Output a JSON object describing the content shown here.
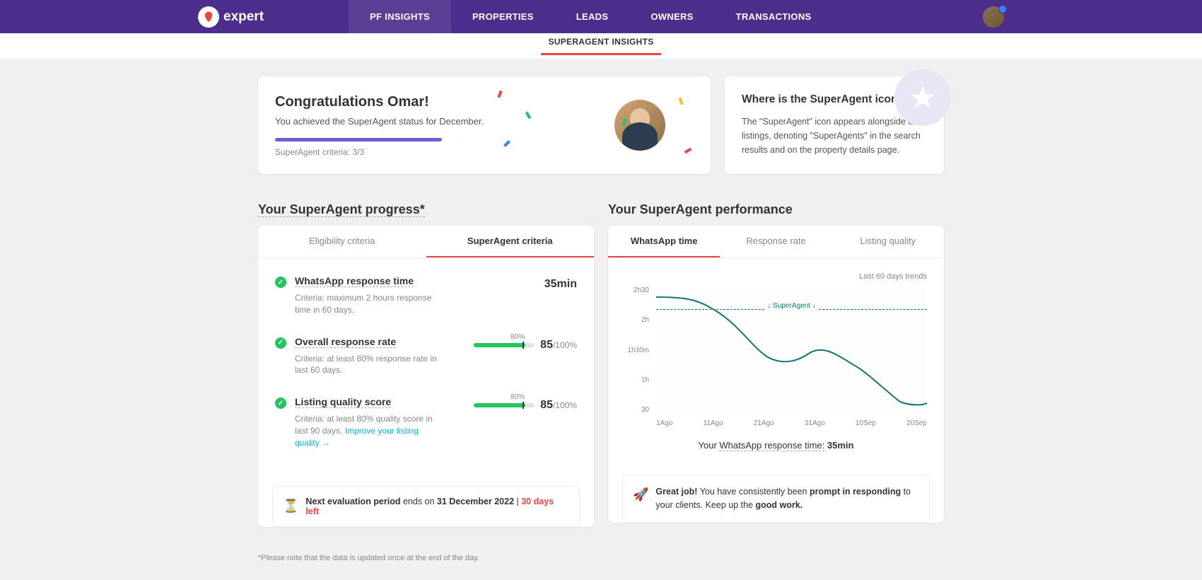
{
  "brand": {
    "name": "expert"
  },
  "nav": {
    "items": [
      "PF INSIGHTS",
      "PROPERTIES",
      "LEADS",
      "OWNERS",
      "TRANSACTIONS"
    ],
    "active_index": 0
  },
  "subnav": {
    "tab": "SUPERAGENT INSIGHTS"
  },
  "congrats": {
    "title": "Congratulations Omar!",
    "subtitle": "You achieved the SuperAgent status for December.",
    "criteria_text": "SuperAgent criteria: 3/3",
    "progress_pct": 100
  },
  "info": {
    "title": "Where is the SuperAgent icon?",
    "body": "The \"SuperAgent\" icon appears alongside all listings, denoting \"SuperAgents\" in the search results and on the property details page."
  },
  "progress_section": {
    "title": "Your SuperAgent progress*",
    "tabs": {
      "left": "Eligibility criteria",
      "right": "SuperAgent criteria",
      "active": "right"
    },
    "criteria": [
      {
        "name": "WhatsApp response time",
        "desc": "Criteria: maximum 2 hours response time in 60 days.",
        "value": "35min",
        "type": "time"
      },
      {
        "name": "Overall response rate",
        "desc": "Criteria: at least 80% response rate in last 60 days.",
        "value": "85",
        "suffix": "/100%",
        "bar_label": "80%",
        "bar_pct": 85,
        "type": "pct"
      },
      {
        "name": "Listing quality score",
        "desc": "Criteria: at least 80% quality score in last 90 days. ",
        "link": "Improve your listing quality",
        "value": "85",
        "suffix": "/100%",
        "bar_label": "80%",
        "bar_pct": 85,
        "type": "pct"
      }
    ],
    "eval": {
      "prefix": "Next evaluation period",
      "mid": " ends on ",
      "date": "31 December 2022",
      "sep": " | ",
      "days_left": "30 days left"
    }
  },
  "performance_section": {
    "title": "Your SuperAgent performance",
    "tabs": [
      "WhatsApp time",
      "Response rate",
      "Listing quality"
    ],
    "active_tab": 0,
    "chart_note": "Last 60 days trends",
    "legend": "↓ SuperAgent ↓",
    "summary_prefix": "Your ",
    "summary_metric": "WhatsApp response time:",
    "summary_value": "35min",
    "feedback": {
      "strong1": "Great job!",
      "part1": " You have consistently been ",
      "strong2": "prompt in responding",
      "part2": " to your clients. Keep up the ",
      "strong3": "good work."
    }
  },
  "chart_data": {
    "type": "line",
    "title": "",
    "xlabel": "",
    "ylabel": "",
    "y_ticks": [
      "2h30",
      "2h",
      "1h30m",
      "1h",
      "30"
    ],
    "x_ticks": [
      "1Ago",
      "11Ago",
      "21Ago",
      "31Ago",
      "10Sep",
      "20Sep"
    ],
    "threshold_minutes": 120,
    "threshold_label": "SuperAgent",
    "ylim_minutes": [
      30,
      150
    ],
    "series": [
      {
        "name": "WhatsApp response time (minutes)",
        "x": [
          "1Ago",
          "5Ago",
          "11Ago",
          "15Ago",
          "21Ago",
          "25Ago",
          "31Ago",
          "5Sep",
          "10Sep",
          "15Sep",
          "20Sep"
        ],
        "values": [
          140,
          138,
          130,
          110,
          88,
          85,
          92,
          82,
          70,
          50,
          35
        ]
      }
    ]
  },
  "footnote": "*Please note that the data is updated once at the end of the day."
}
